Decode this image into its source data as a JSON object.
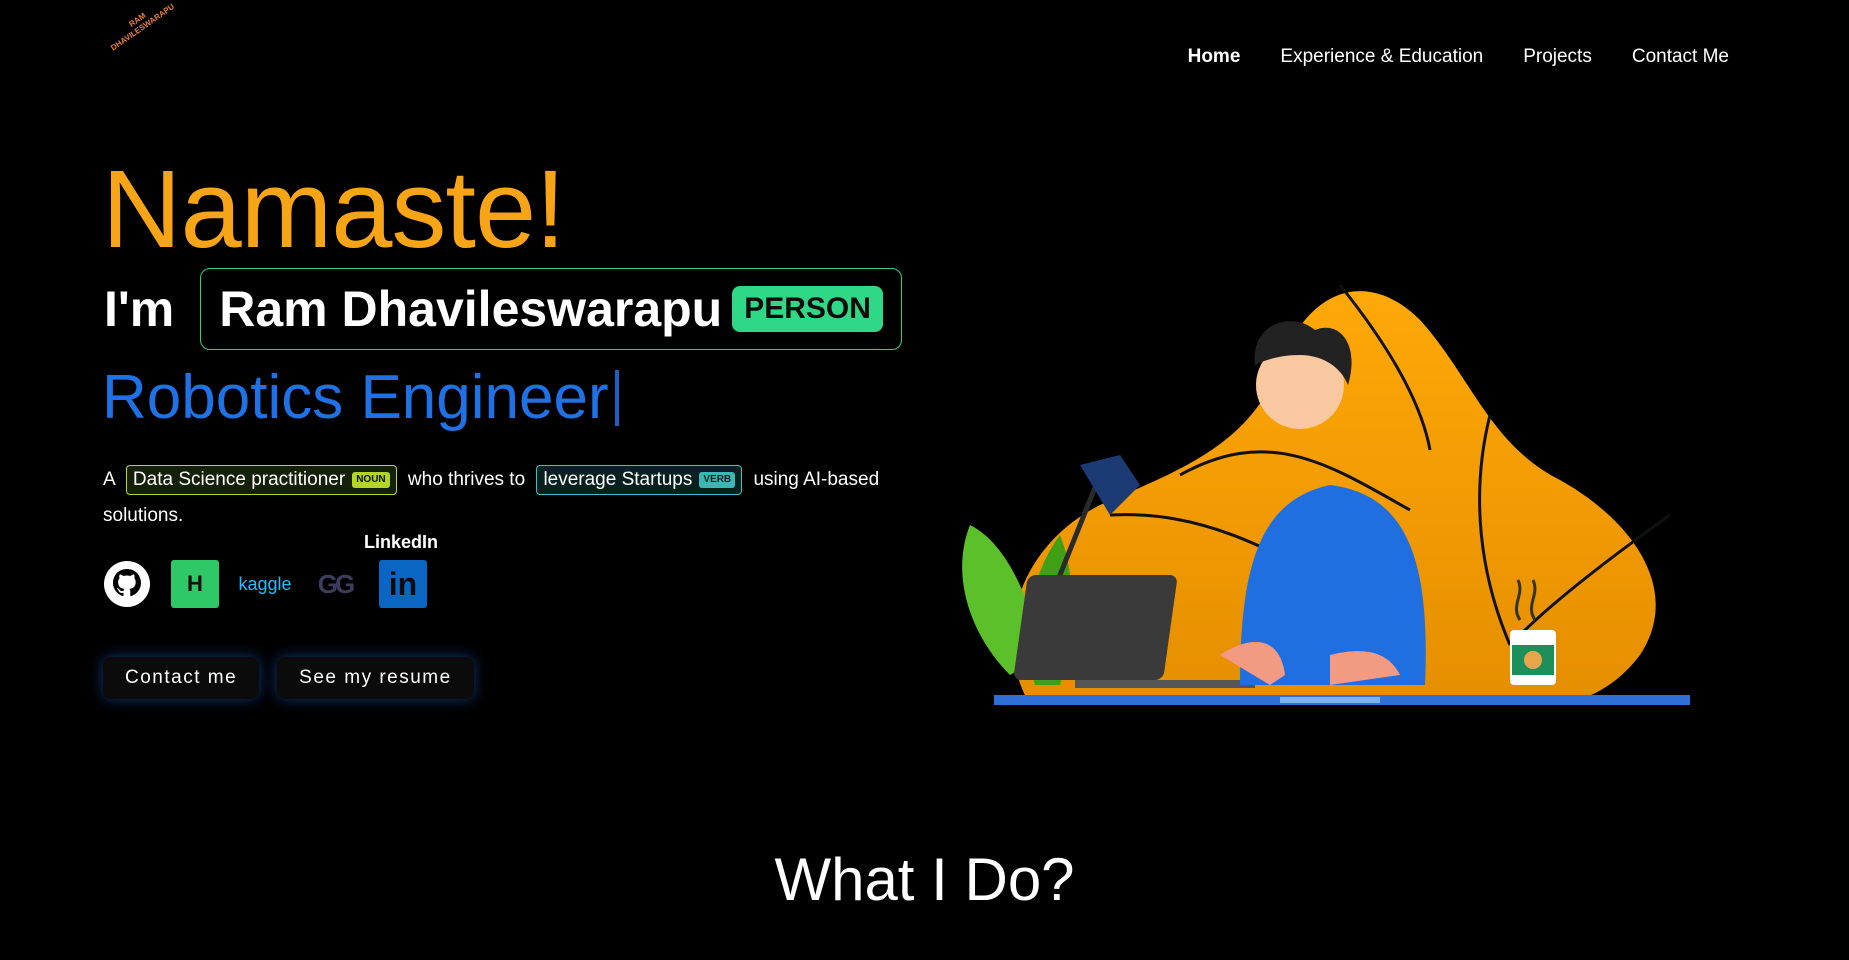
{
  "logo": {
    "line1": "RAM",
    "line2": "DHAVILESWARAPU"
  },
  "nav": {
    "items": [
      {
        "label": "Home"
      },
      {
        "label": "Experience & Education"
      },
      {
        "label": "Projects"
      },
      {
        "label": "Contact Me"
      }
    ]
  },
  "hero": {
    "greeting": "Namaste!",
    "im_label": "I'm",
    "name": "Ram Dhavileswarapu",
    "name_tag": "PERSON",
    "role": "Robotics Engineer",
    "desc_prefix": "A",
    "chip1": {
      "text": "Data Science practitioner",
      "tag": "NOUN"
    },
    "desc_middle": "who thrives to",
    "chip2": {
      "text": "leverage Startups",
      "tag": "VERB"
    },
    "desc_suffix": "using AI-based solutions."
  },
  "socials": {
    "hackerrank_glyph": "H",
    "kaggle_text": "kaggle",
    "gfg_text": "GG",
    "linkedin_glyph": "in",
    "linkedin_tooltip": "LinkedIn",
    "icons": [
      "github-icon",
      "hackerrank-icon",
      "kaggle-icon",
      "geeksforgeeks-icon",
      "linkedin-icon"
    ]
  },
  "buttons": {
    "contact": "Contact me",
    "resume": "See my resume"
  },
  "section": {
    "title": "What I Do?"
  },
  "colors": {
    "accent_orange": "#f7a516",
    "accent_blue": "#1f72e6",
    "person_tag": "#2fd887",
    "noun_tag": "#b3d623",
    "verb_tag": "#3bb8b4"
  }
}
